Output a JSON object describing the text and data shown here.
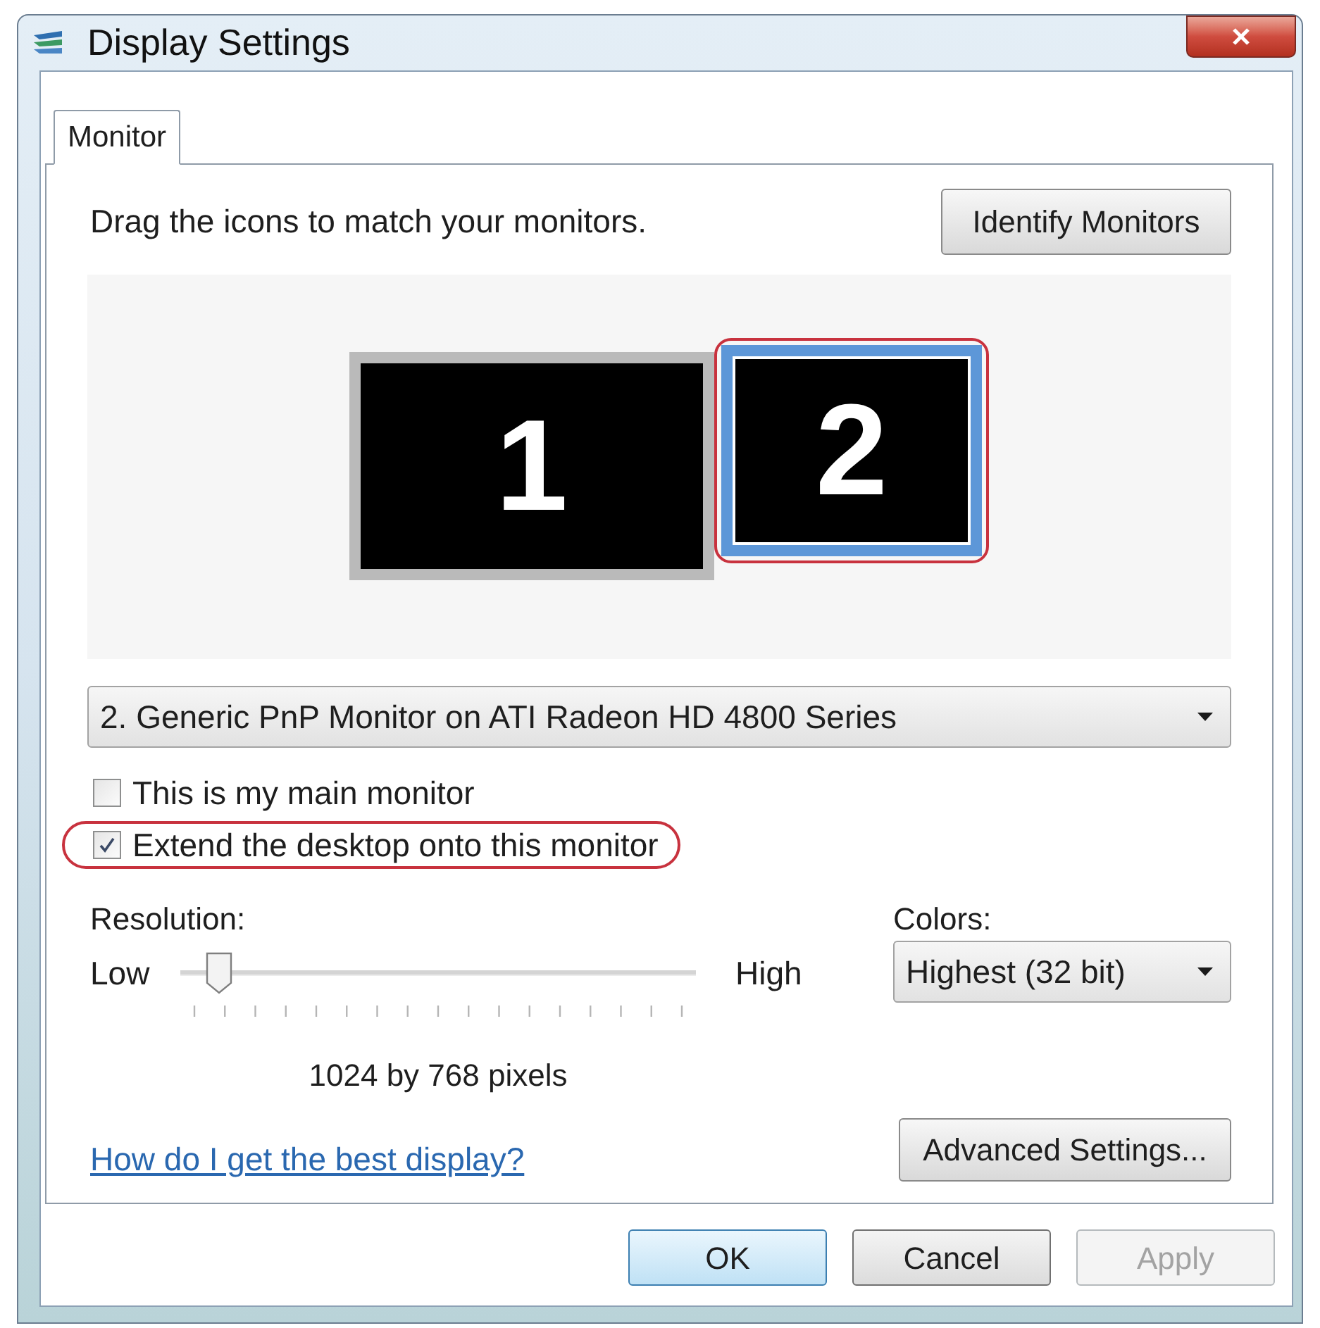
{
  "window": {
    "title": "Display Settings"
  },
  "tabs": [
    {
      "label": "Monitor",
      "selected": true
    }
  ],
  "instruction": "Drag the icons to match your monitors.",
  "identify_button": "Identify Monitors",
  "monitors": [
    {
      "label": "1",
      "selected": false,
      "highlighted": false
    },
    {
      "label": "2",
      "selected": true,
      "highlighted": true
    }
  ],
  "monitor_select": {
    "value": "2. Generic PnP Monitor on ATI Radeon HD 4800 Series"
  },
  "checkboxes": [
    {
      "label": "This is my main monitor",
      "checked": false,
      "highlighted": false
    },
    {
      "label": "Extend the desktop onto this monitor",
      "checked": true,
      "highlighted": true
    }
  ],
  "resolution": {
    "label": "Resolution:",
    "low_label": "Low",
    "high_label": "High",
    "level": 0.05,
    "reading": "1024 by 768 pixels"
  },
  "colors": {
    "label": "Colors:",
    "value": "Highest (32 bit)"
  },
  "help_link": "How do I get the best display?",
  "advanced_button": "Advanced Settings...",
  "buttons": [
    {
      "label": "OK",
      "default": true,
      "disabled": false
    },
    {
      "label": "Cancel",
      "default": false,
      "disabled": false
    },
    {
      "label": "Apply",
      "default": false,
      "disabled": true
    }
  ]
}
